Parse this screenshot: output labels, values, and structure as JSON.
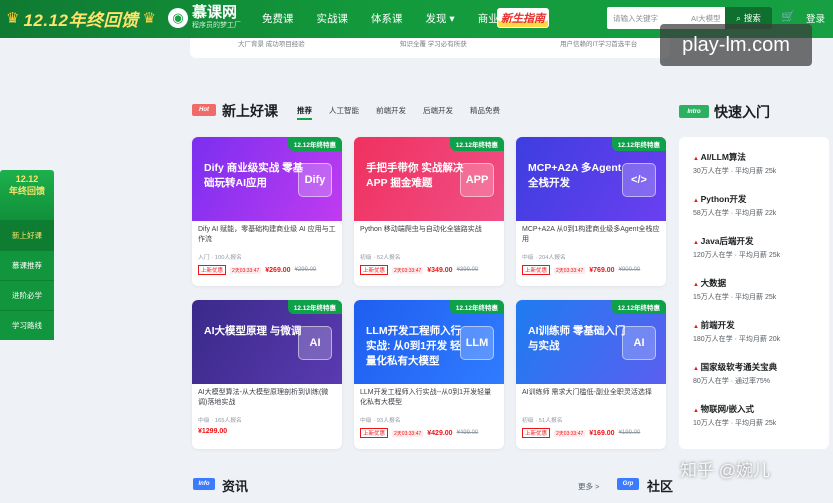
{
  "header": {
    "promo_text": "12.12年终回馈",
    "logo_name": "慕课网",
    "logo_slogan": "程序员的梦工厂",
    "nav": [
      "免费课",
      "实战课",
      "体系课",
      "发现 ▾",
      "商业合作 ▾"
    ],
    "guide_label": "新生指南",
    "search_placeholder": "请输入关键字",
    "search_ai": "AI大模型",
    "search_button": "搜索",
    "login": "登录"
  },
  "strip": [
    "大厂背景 成功项目经验",
    "知识全覆 学习必有所获",
    "用户信赖的IT学习首选平台"
  ],
  "left_promo": {
    "title_line1": "12.12",
    "title_line2": "年终回馈",
    "items": [
      "新上好课",
      "慕课推荐",
      "进阶必学",
      "学习路线"
    ]
  },
  "new_courses": {
    "badge": "Hot",
    "title": "新上好课",
    "tabs": [
      "推荐",
      "人工智能",
      "前端开发",
      "后端开发",
      "精品免费"
    ],
    "active_tab": 0
  },
  "courses": [
    {
      "tag": "12.12年终特惠",
      "headline": "Dify 商业级实战 零基础玩转AI应用",
      "art": "Dify",
      "color1": "#7b2ff0",
      "color2": "#c03bf0",
      "title": "Dify AI 赋能，零基础构建商业级 AI 应用与工作流",
      "meta": "入门 · 100人报名",
      "pill": "上新优惠",
      "countdown": "2天03:33:47",
      "price": "¥269.00",
      "old": "¥299.00"
    },
    {
      "tag": "12.12年终特惠",
      "headline": "手把手带你 实战解决 APP 掘金难题",
      "art": "APP",
      "color1": "#f0315f",
      "color2": "#f04f86",
      "title": "Python 移动端爬虫与自动化全链路实战",
      "meta": "初级 · 52人报名",
      "pill": "上新优惠",
      "countdown": "2天03:33:47",
      "price": "¥349.00",
      "old": "¥399.00"
    },
    {
      "tag": "12.12年终特惠",
      "headline": "MCP+A2A 多Agent全栈开发",
      "art": "</>",
      "color1": "#3d3ee0",
      "color2": "#6b3ff0",
      "title": "MCP+A2A 从0到1构建商业级多Agent全栈应用",
      "meta": "中级 · 204人报名",
      "pill": "上新优惠",
      "countdown": "2天03:33:47",
      "price": "¥769.00",
      "old": "¥900.00"
    },
    {
      "tag": "12.12年终特惠",
      "headline": "AI大模型原理 与微调",
      "art": "AI",
      "color1": "#3a2a8a",
      "color2": "#5a3ab0",
      "title": "AI大模型算法-从大模型原理剖析到训练(微调)落地实战",
      "meta": "中级 · 165人报名",
      "pill": "",
      "countdown": "",
      "price": "¥1299.00",
      "old": ""
    },
    {
      "tag": "12.12年终特惠",
      "headline": "LLM开发工程师入行 实战: 从0到1开发 轻量化私有大模型",
      "art": "LLM",
      "color1": "#1f5ef0",
      "color2": "#2f7cff",
      "title": "LLM开发工程师入行实战--从0到1开发轻量化私有大模型",
      "meta": "中级 · 93人报名",
      "pill": "上新优惠",
      "countdown": "2天03:33:47",
      "price": "¥429.00",
      "old": "¥499.00"
    },
    {
      "tag": "12.12年终特惠",
      "headline": "AI训练师 零基础入门与实战",
      "art": "AI",
      "color1": "#1f7cf0",
      "color2": "#5a5ff0",
      "title": "AI训练师 需求大门槛低-副业全职灵活选择",
      "meta": "初级 · 51人报名",
      "pill": "上新优惠",
      "countdown": "2天03:33:47",
      "price": "¥169.00",
      "old": "¥199.00"
    }
  ],
  "quick_intro": {
    "badge": "Intro",
    "title": "快速入门",
    "items": [
      {
        "name": "AI/LLM算法",
        "stat": "30万人在学 · 平均月薪 25k"
      },
      {
        "name": "Python开发",
        "stat": "58万人在学 · 平均月薪 22k"
      },
      {
        "name": "Java后端开发",
        "stat": "120万人在学 · 平均月薪 25k"
      },
      {
        "name": "大数据",
        "stat": "15万人在学 · 平均月薪 25k"
      },
      {
        "name": "前端开发",
        "stat": "180万人在学 · 平均月薪 20k"
      },
      {
        "name": "国家级软考通关宝典",
        "stat": "80万人在学 · 通过率75%"
      },
      {
        "name": "物联网/嵌入式",
        "stat": "10万人在学 · 平均月薪 25k"
      }
    ]
  },
  "bottom": {
    "info_badge": "Info",
    "info_title": "资讯",
    "more": "更多 >",
    "grp_badge": "Grp",
    "grp_title": "社区"
  },
  "watermarks": {
    "site": "play-lm.com",
    "zhihu": "知乎 @婉儿"
  }
}
